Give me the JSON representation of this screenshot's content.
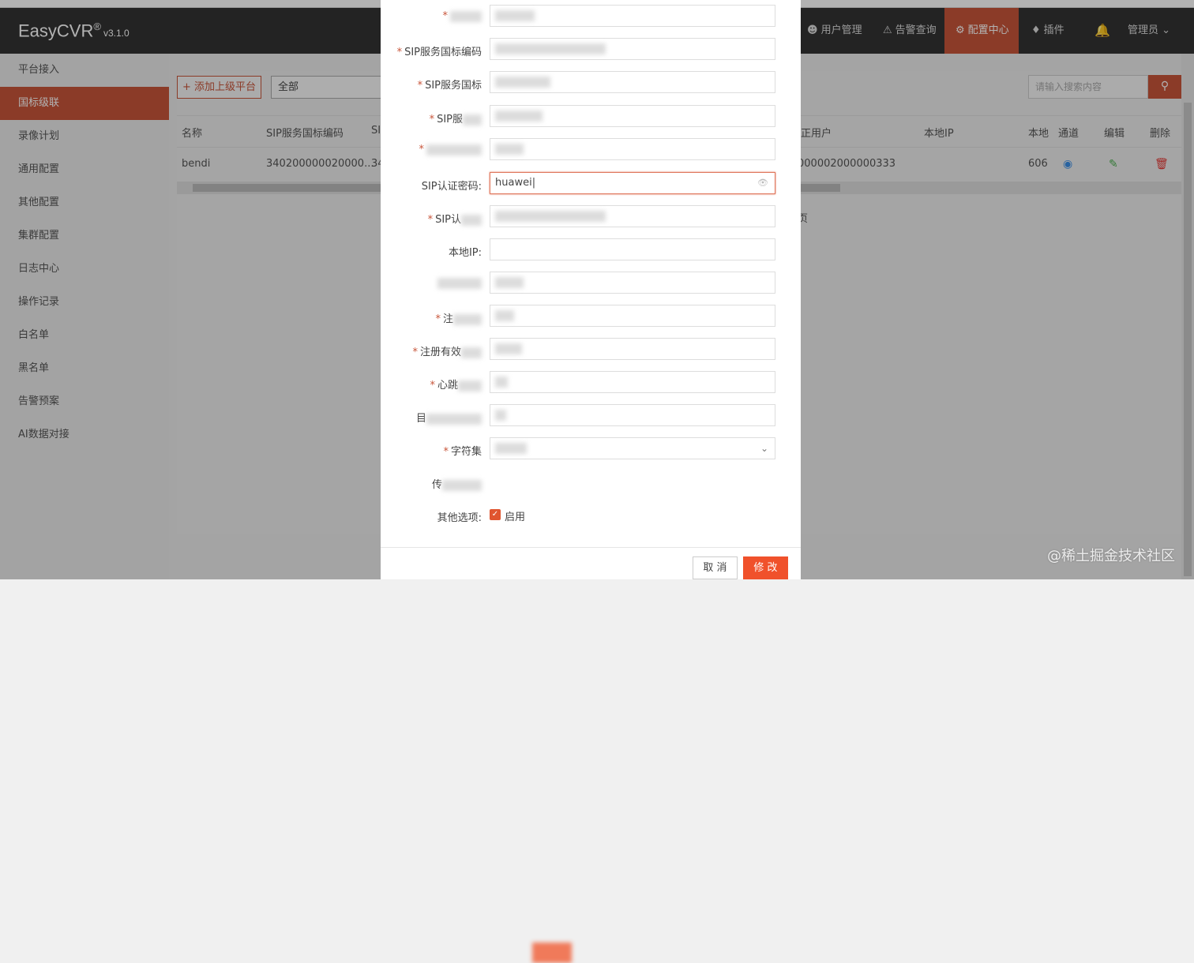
{
  "app": {
    "logo": "EasyCVR",
    "logo_mark": "®",
    "version": "v3.1.0"
  },
  "topnav": [
    {
      "label": "用户管理",
      "icon": "user-icon",
      "active": false
    },
    {
      "label": "告警查询",
      "icon": "alarm-icon",
      "active": false
    },
    {
      "label": "配置中心",
      "icon": "gear-icon",
      "active": true
    },
    {
      "label": "插件",
      "icon": "puzzle-icon",
      "active": false
    }
  ],
  "admin": {
    "label": "管理员",
    "bell_icon": "bell-icon"
  },
  "sidebar": {
    "items": [
      {
        "label": "平台接入"
      },
      {
        "label": "国标级联"
      },
      {
        "label": "录像计划"
      },
      {
        "label": "通用配置"
      },
      {
        "label": "其他配置"
      },
      {
        "label": "集群配置"
      },
      {
        "label": "日志中心"
      },
      {
        "label": "操作记录"
      },
      {
        "label": "白名单"
      },
      {
        "label": "黑名单"
      },
      {
        "label": "告警预案"
      },
      {
        "label": "AI数据对接"
      }
    ],
    "active_index": 1
  },
  "toolbar": {
    "add_label": "添加上级平台",
    "filter_value": "全部",
    "search_placeholder": "请输入搜索内容"
  },
  "table": {
    "columns": [
      "名称",
      "SIP服务国标编码",
      "SIP",
      "正用户",
      "本地IP",
      "本地",
      "通道",
      "编辑",
      "删除"
    ],
    "row": {
      "name": "bendi",
      "sip_code": "340200000020000...",
      "sip_short": "34",
      "user": "000002000000333",
      "local_port": "606"
    },
    "empty_hint": "页"
  },
  "modal": {
    "fields": [
      {
        "label": "",
        "required": true,
        "value": "",
        "blurred": true
      },
      {
        "label": "SIP服务国标编码",
        "required": true,
        "value": "",
        "blurred": true
      },
      {
        "label": "SIP服务国标",
        "required": true,
        "value": "",
        "blurred": true
      },
      {
        "label": "SIP服",
        "required": true,
        "value": "",
        "blurred": true
      },
      {
        "label": "",
        "required": true,
        "value": "",
        "blurred": true
      },
      {
        "label": "SIP认证密码:",
        "required": false,
        "value": "huawei",
        "blurred": false,
        "focused": true
      },
      {
        "label": "SIP认",
        "required": true,
        "value": "",
        "blurred": true
      },
      {
        "label": "本地IP:",
        "required": false,
        "value": "",
        "blurred": false
      },
      {
        "label": "",
        "required": false,
        "value": "",
        "blurred": true
      },
      {
        "label": "注",
        "required": true,
        "value": "",
        "blurred": true
      },
      {
        "label": "注册有效",
        "required": true,
        "value": "",
        "blurred": true
      },
      {
        "label": "心跳",
        "required": true,
        "value": "",
        "blurred": true
      },
      {
        "label": "目",
        "required": false,
        "value": "",
        "blurred": true
      },
      {
        "label": "字符集",
        "required": true,
        "value": "",
        "blurred": true,
        "select": true
      }
    ],
    "transport_label": "传",
    "other_label": "其他选项:",
    "enable_label": "启用",
    "cancel_label": "取 消",
    "confirm_label": "修 改"
  },
  "watermark": "@稀土掘金技术社区",
  "colors": {
    "accent": "#c8553a",
    "topbar": "#333333",
    "primary_button": "#f0512b"
  }
}
